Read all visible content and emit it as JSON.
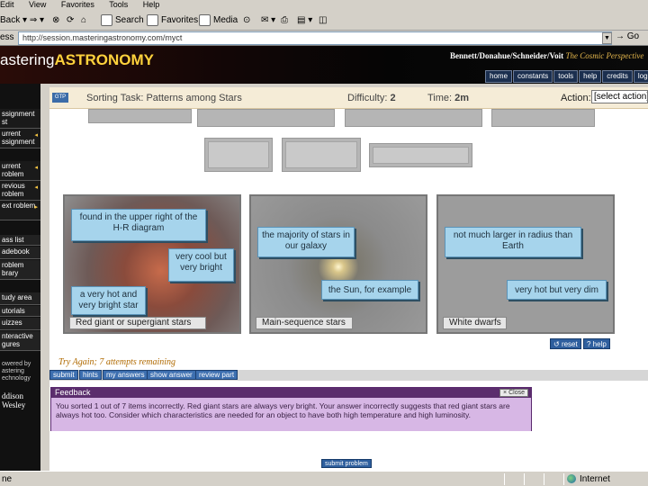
{
  "browser": {
    "menu": [
      "Edit",
      "View",
      "Favorites",
      "Tools",
      "Help"
    ],
    "toolbar": {
      "back": "Back",
      "search": "Search",
      "favorites": "Favorites",
      "media": "Media"
    },
    "address_label": "ess",
    "address_value": "http://session.masteringastronomy.com/myct",
    "go": "Go",
    "status_left": "ne",
    "status_zone": "Internet"
  },
  "site": {
    "logo_pre": "astering",
    "logo_main": "ASTRONOMY",
    "authors": "Bennett/Donahue/Schneider/Voit",
    "tagline": "The Cosmic Perspective",
    "nav": [
      "home",
      "constants",
      "tools",
      "help",
      "credits",
      "log out"
    ]
  },
  "sidebar": {
    "items": [
      {
        "label": "ssignment st",
        "arrow": ""
      },
      {
        "label": "urrent ssignment",
        "arrow": "◂"
      },
      {
        "label": "urrent roblem",
        "arrow": "◂"
      },
      {
        "label": "revious roblem",
        "arrow": "◂"
      },
      {
        "label": "ext roblem",
        "arrow": "▸"
      },
      {
        "label": "ass list",
        "arrow": ""
      },
      {
        "label": "adebook",
        "arrow": ""
      },
      {
        "label": "roblem brary",
        "arrow": ""
      },
      {
        "label": "tudy area",
        "arrow": ""
      },
      {
        "label": "utorials",
        "arrow": ""
      },
      {
        "label": "uizzes",
        "arrow": ""
      },
      {
        "label": "nteractive gures",
        "arrow": ""
      }
    ],
    "credits": "owered by astering echnology",
    "publisher": "ddison Wesley"
  },
  "task": {
    "badge": "GTP",
    "title": "Sorting Task: Patterns among Stars",
    "difficulty_label": "Difficulty:",
    "difficulty_value": "2",
    "time_label": "Time:",
    "time_value": "2m",
    "action_label": "Action:",
    "action_value": "[select action]"
  },
  "panels": {
    "red": {
      "label": "Red giant or supergiant stars",
      "cards": [
        "found in the upper right of the H-R diagram",
        "very cool but very bright",
        "a very hot and very bright star"
      ]
    },
    "main": {
      "label": "Main-sequence stars",
      "cards": [
        "the majority of stars in our galaxy",
        "the Sun, for example"
      ]
    },
    "white": {
      "label": "White dwarfs",
      "cards": [
        "not much larger in radius than Earth",
        "very hot but very dim"
      ]
    }
  },
  "controls": {
    "reset": "reset",
    "help": "help",
    "try_again": "Try Again; 7 attempts remaining",
    "actions": [
      "submit",
      "hints",
      "my answers",
      "show answer",
      "review part"
    ],
    "submit_problem": "submit problem"
  },
  "feedback": {
    "title": "Feedback",
    "close": "Close",
    "text": "You sorted 1 out of 7 items incorrectly. Red giant stars are always very bright. Your answer incorrectly suggests that red giant stars are always hot too. Consider which characteristics are needed for an object to have both high temperature and high luminosity."
  }
}
